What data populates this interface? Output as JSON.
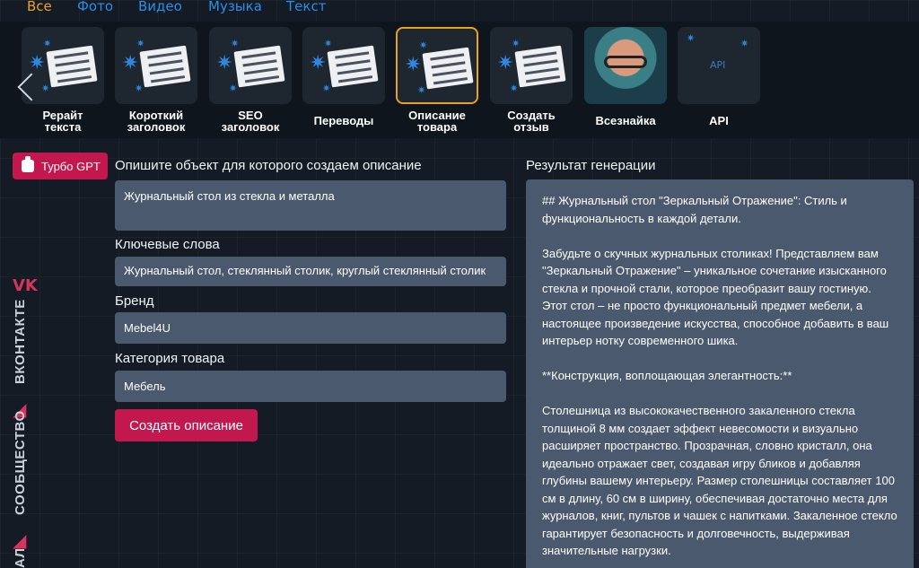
{
  "nav": {
    "items": [
      "Все",
      "Фото",
      "Видео",
      "Музыка",
      "Текст"
    ],
    "active": "Все"
  },
  "tools": [
    {
      "label_line1": "Рерайт",
      "label_line2": "текста",
      "icon": "magic-wand-paper"
    },
    {
      "label_line1": "Короткий",
      "label_line2": "заголовок",
      "icon": "magic-wand-paper"
    },
    {
      "label_line1": "SEO",
      "label_line2": "заголовок",
      "icon": "magic-wand-paper"
    },
    {
      "label_line1": "Переводы",
      "label_line2": "",
      "icon": "magic-wand-paper"
    },
    {
      "label_line1": "Описание",
      "label_line2": "товара",
      "icon": "magic-wand-paper",
      "selected": true
    },
    {
      "label_line1": "Создать",
      "label_line2": "отзыв",
      "icon": "magic-wand-paper"
    },
    {
      "label_line1": "Всезнайка",
      "label_line2": "",
      "icon": "avatar"
    },
    {
      "label_line1": "API",
      "label_line2": "",
      "icon": "api",
      "thumb_text": "API"
    }
  ],
  "sidebar": {
    "vk": "ВКОНТАКТЕ",
    "community": "СООБЩЕСТВО",
    "channel": "АЛ"
  },
  "turbo": {
    "label": "Турбо GPT"
  },
  "form": {
    "object_label": "Опишите объект для которого создаем описание",
    "object_value": "Журнальный стол из стекла и металла",
    "keywords_label": "Ключевые слова",
    "keywords_value": "Журнальный стол, стеклянный столик, круглый стеклянный столик",
    "brand_label": "Бренд",
    "brand_value": "Mebel4U",
    "category_label": "Категория товара",
    "category_value": "Мебель",
    "submit_label": "Создать описание"
  },
  "result": {
    "label": "Результат генерации",
    "paragraphs": [
      "##  Журнальный стол \"Зеркальный Отражение\":  Стиль и функциональность в каждой детали.",
      "Забудьте о скучных журнальных столиках! Представляем вам \"Зеркальный Отражение\" –  уникальное сочетание изысканного стекла и прочной стали, которое преобразит вашу гостиную. Этот стол – не просто функциональный предмет мебели, а настоящее произведение искусства, способное добавить в ваш интерьер нотку современного шика.",
      "**Конструкция, воплощающая элегантность:**",
      "Столешница из высококачественного закаленного стекла толщиной 8 мм создает эффект невесомости и визуально расширяет пространство.  Прозрачная, словно кристалл, она идеально отражает свет, создавая игру бликов и добавляя глубины вашему интерьеру.  Размер столешницы составляет 100 см в длину, 60 см в ширину, обеспечивая достаточно места для журналов, книг, пультов и чашек с напитками.  Закаленное стекло гарантирует безопасность и долговечность, выдерживая значительные нагрузки."
    ]
  },
  "colors": {
    "accent": "#c2184e",
    "active_nav": "#e9a21f",
    "link": "#2b8de8",
    "field_bg": "#4a596d"
  }
}
